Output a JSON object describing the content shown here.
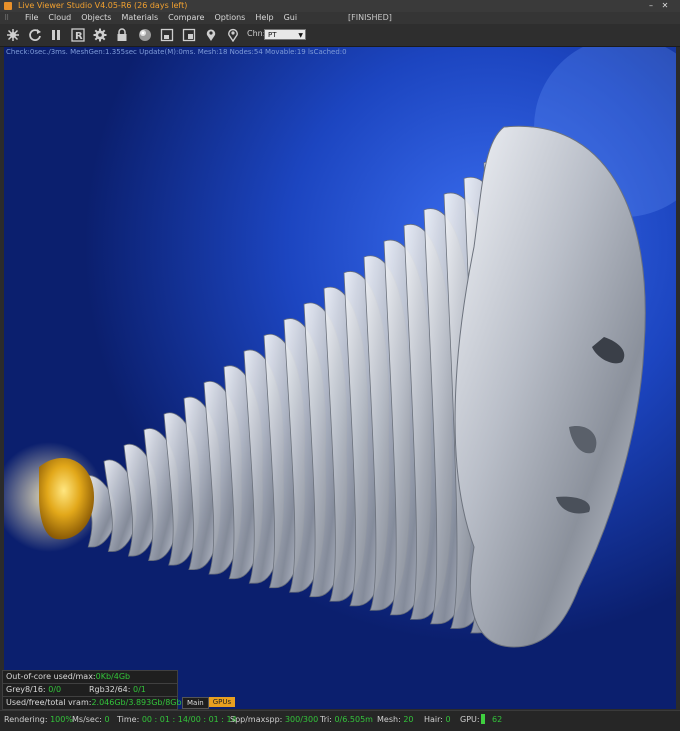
{
  "window": {
    "title": "Live Viewer Studio V4.05-R6 (26 days left)",
    "status": "[FINISHED]"
  },
  "menu": [
    "File",
    "Cloud",
    "Objects",
    "Materials",
    "Compare",
    "Options",
    "Help",
    "Gui"
  ],
  "toolbar": {
    "icons": [
      "settings-burst-icon",
      "refresh-icon",
      "pause-icon",
      "r-icon",
      "gear-icon",
      "lock-icon",
      "sphere-icon",
      "region-icon",
      "region-focus-icon",
      "pin-icon",
      "pin-outline-icon"
    ],
    "channel_label": "Chn:",
    "channel_value": "PT"
  },
  "render_info": "Check:0sec./3ms. MeshGen:1.355sec Update(M):0ms. Mesh:18 Nodes:54 Movable:19 lsCached:0",
  "stats": {
    "out_of_core_label": "Out-of-core used/max:",
    "out_of_core_value": "0Kb/4Gb",
    "grey_label": "Grey8/16:",
    "grey_value": "0/0",
    "rgb_label": "Rgb32/64:",
    "rgb_value": "0/1",
    "vram_label": "Used/free/total vram:",
    "vram_value": "2.046Gb/3.893Gb/8Gb"
  },
  "tabs": [
    "Main",
    "GPUs"
  ],
  "statusbar": {
    "rendering_label": "Rendering:",
    "rendering_value": "100%",
    "ms_label": "Ms/sec:",
    "ms_value": "0",
    "time_label": "Time:",
    "time_value": "00 : 01 : 14/00 : 01 : 14",
    "spp_label": "Spp/maxspp:",
    "spp_value": "300/300",
    "tri_label": "Tri:",
    "tri_value": "0/6.505m",
    "mesh_label": "Mesh:",
    "mesh_value": "20",
    "hair_label": "Hair:",
    "hair_value": "0",
    "gpu_label": "GPU:",
    "gpu_value": "62"
  },
  "colors": {
    "accent": "#f0a030",
    "value_green": "#33c43b",
    "background_blue": "#1a3fb8"
  }
}
